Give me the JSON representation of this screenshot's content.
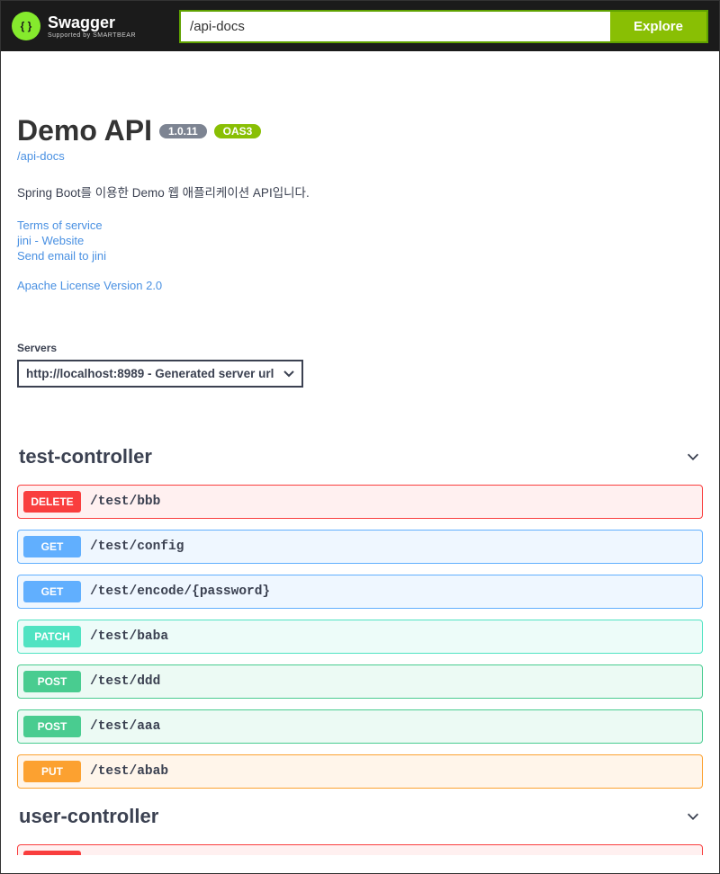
{
  "topbar": {
    "brand": "Swagger",
    "brand_sub": "Supported by SMARTBEAR",
    "url_value": "/api-docs",
    "explore_label": "Explore"
  },
  "info": {
    "title": "Demo API",
    "version": "1.0.11",
    "oas": "OAS3",
    "docs_url": "/api-docs",
    "description": "Spring Boot를 이용한 Demo 웹 애플리케이션 API입니다.",
    "terms": "Terms of service",
    "contact_site": "jini - Website",
    "contact_email": "Send email to jini",
    "license": "Apache License Version 2.0"
  },
  "servers": {
    "label": "Servers",
    "selected": "http://localhost:8989 - Generated server url"
  },
  "tags": [
    {
      "name": "test-controller",
      "operations": [
        {
          "method": "DELETE",
          "path": "/test/bbb",
          "class": "op-delete"
        },
        {
          "method": "GET",
          "path": "/test/config",
          "class": "op-get"
        },
        {
          "method": "GET",
          "path": "/test/encode/{password}",
          "class": "op-get"
        },
        {
          "method": "PATCH",
          "path": "/test/baba",
          "class": "op-patch"
        },
        {
          "method": "POST",
          "path": "/test/ddd",
          "class": "op-post"
        },
        {
          "method": "POST",
          "path": "/test/aaa",
          "class": "op-post"
        },
        {
          "method": "PUT",
          "path": "/test/abab",
          "class": "op-put"
        }
      ]
    },
    {
      "name": "user-controller",
      "operations": []
    }
  ]
}
